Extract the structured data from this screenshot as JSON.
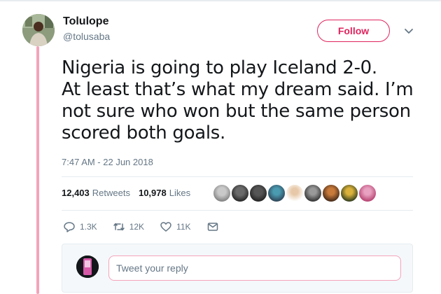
{
  "user": {
    "name": "Tolulope",
    "handle": "@tolusaba"
  },
  "header": {
    "follow_label": "Follow"
  },
  "tweet": {
    "lines": [
      "Nigeria is going to play Iceland 2-0.",
      "At least that’s what my dream said. I’m",
      "not sure who won but the same person",
      "scored both goals."
    ],
    "timestamp": "7:47 AM - 22 Jun 2018"
  },
  "stats": {
    "retweets_count": "12,403",
    "retweets_label": "Retweets",
    "likes_count": "10,978",
    "likes_label": "Likes",
    "liker_avatar_count": 9
  },
  "actions": {
    "reply_count": "1.3K",
    "retweet_count": "12K",
    "like_count": "11K"
  },
  "reply": {
    "placeholder": "Tweet your reply"
  },
  "colors": {
    "accent": "#e0245e",
    "thread_line": "#f4a3ba",
    "muted_text": "#657786"
  }
}
